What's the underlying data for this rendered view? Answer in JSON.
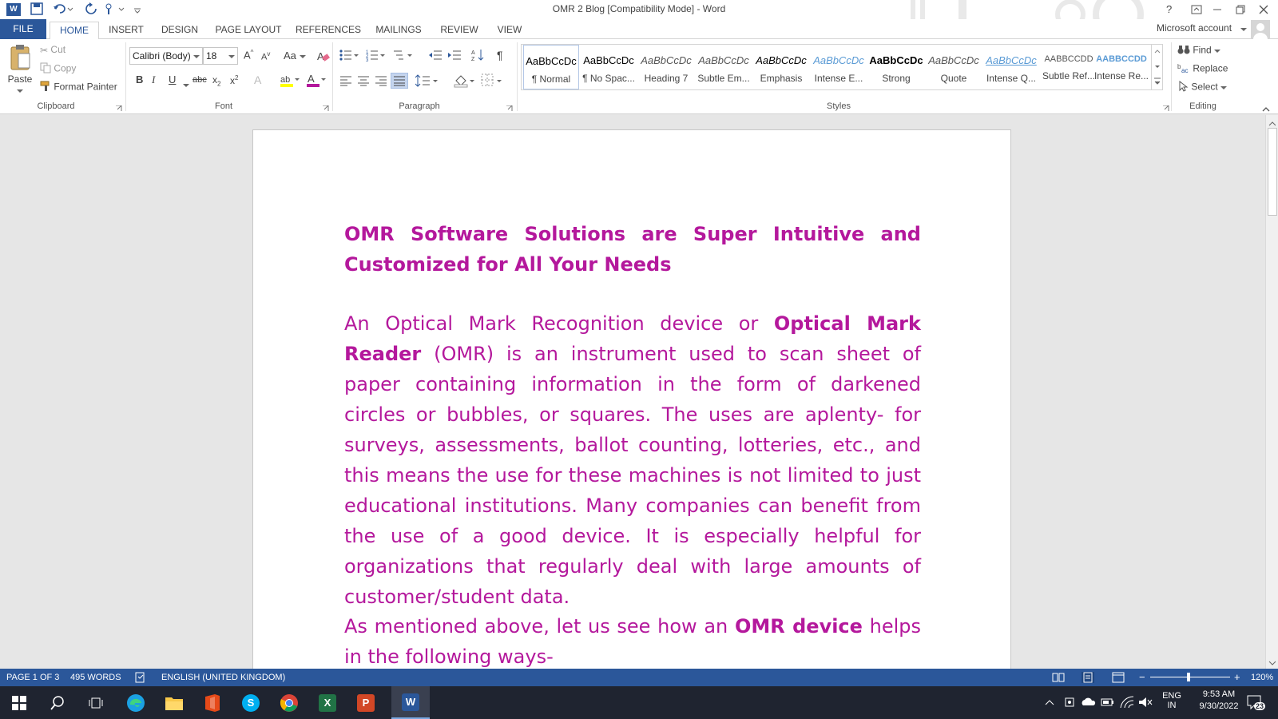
{
  "titlebar": {
    "title": "OMR 2 Blog [Compatibility Mode] - Word",
    "help": "?",
    "account": "Microsoft account"
  },
  "tabs": [
    {
      "label": "FILE"
    },
    {
      "label": "HOME"
    },
    {
      "label": "INSERT"
    },
    {
      "label": "DESIGN"
    },
    {
      "label": "PAGE LAYOUT"
    },
    {
      "label": "REFERENCES"
    },
    {
      "label": "MAILINGS"
    },
    {
      "label": "REVIEW"
    },
    {
      "label": "VIEW"
    }
  ],
  "clipboard": {
    "paste": "Paste",
    "cut": "Cut",
    "copy": "Copy",
    "format_painter": "Format Painter",
    "label": "Clipboard"
  },
  "font": {
    "family": "Calibri (Body)",
    "size": "18",
    "change_case": "Aa",
    "bold": "B",
    "italic": "I",
    "underline": "U",
    "strike": "abc",
    "label": "Font"
  },
  "paragraph": {
    "label": "Paragraph"
  },
  "styles": {
    "label": "Styles",
    "items": [
      {
        "preview": "AaBbCcDc",
        "name": "¶ Normal"
      },
      {
        "preview": "AaBbCcDc",
        "name": "¶ No Spac..."
      },
      {
        "preview": "AaBbCcDc",
        "name": "Heading 7"
      },
      {
        "preview": "AaBbCcDc",
        "name": "Subtle Em..."
      },
      {
        "preview": "AaBbCcDc",
        "name": "Emphasis"
      },
      {
        "preview": "AaBbCcDc",
        "name": "Intense E..."
      },
      {
        "preview": "AaBbCcDc",
        "name": "Strong"
      },
      {
        "preview": "AaBbCcDc",
        "name": "Quote"
      },
      {
        "preview": "AaBbCcDc",
        "name": "Intense Q..."
      },
      {
        "preview": "AABBCCDD",
        "name": "Subtle Ref..."
      },
      {
        "preview": "AABBCCDD",
        "name": "Intense Re..."
      }
    ]
  },
  "editing": {
    "find": "Find",
    "replace": "Replace",
    "select": "Select",
    "label": "Editing"
  },
  "document": {
    "heading": "OMR Software Solutions are Super Intuitive and Customized for All Your Needs",
    "p1_a": "An Optical Mark Recognition device or ",
    "p1_bold": "Optical Mark Reader",
    "p1_b": " (OMR) is an instrument used to scan sheet of paper containing information in the form of darkened circles or bubbles, or squares. The uses are aplenty- for surveys, assessments, ballot counting, lotteries, etc., and this means the use for these machines is not limited to just educational institutions. Many companies can benefit from the use of a good device. It is especially helpful for organizations that regularly deal with large amounts of customer/student data.",
    "p2_a": "As mentioned above, let us see how an ",
    "p2_bold": "OMR device",
    "p2_b": " helps in the following ways-",
    "text_color": "#b4189c"
  },
  "status": {
    "page": "PAGE 1 OF 3",
    "words": "495 WORDS",
    "language": "ENGLISH (UNITED KINGDOM)",
    "zoom": "120%"
  },
  "taskbar": {
    "lang1": "ENG",
    "lang2": "IN",
    "time": "9:53 AM",
    "date": "9/30/2022",
    "notif": "23"
  },
  "colors": {
    "word_blue": "#2b579a",
    "doc_text": "#b4189c"
  }
}
